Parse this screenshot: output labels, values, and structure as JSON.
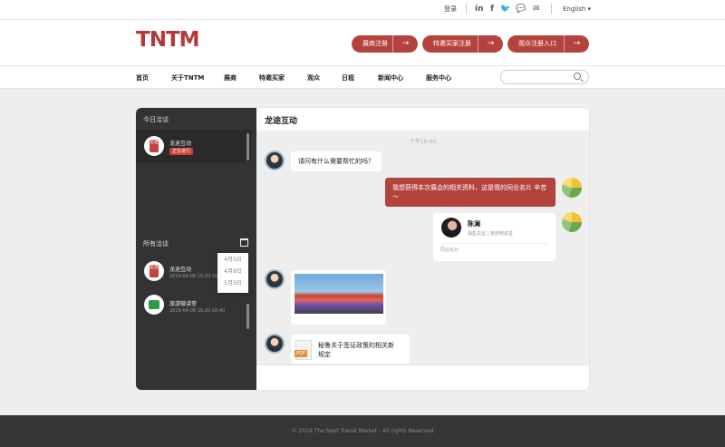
{
  "topbar": {
    "login": "登录",
    "social": [
      "in",
      "f",
      "t",
      "wechat",
      "mail"
    ],
    "social_labels": [
      "in",
      "f",
      "🐦",
      "💬",
      "✉"
    ],
    "language": "English"
  },
  "header": {
    "logo": "TNTM",
    "buttons": [
      "展商注册",
      "特邀买家注册",
      "观众注册入口"
    ]
  },
  "nav": {
    "items": [
      "首页",
      "关于TNTM",
      "展商",
      "特邀买家",
      "观众",
      "日程",
      "新闻中心",
      "服务中心"
    ],
    "search_placeholder": ""
  },
  "sidebar": {
    "today_title": "今日洽谈",
    "today": [
      {
        "name": "龙途互动",
        "badge": "正在进行"
      }
    ],
    "all_title": "所有洽谈",
    "all": [
      {
        "name": "龙途互动",
        "time": "2019-04-08  15:20-16:40"
      },
      {
        "name": "旅游微讲堂",
        "time": "2019-04-08  16:20-16:40"
      }
    ],
    "date_options": [
      "4月5日",
      "4月8日",
      "5月3日"
    ]
  },
  "chat": {
    "title": "龙途互动",
    "timestamp": "下午16:00",
    "msg1": "请问有什么需要帮忙的吗？",
    "msg2": "我想获得本次展会的相关资料，这是我的同业名片  辛苦～",
    "card": {
      "name": "陈澜",
      "role": "销售总监  |  旅游微讲堂",
      "footer": "同业名片"
    },
    "file": {
      "icon": "PDF",
      "name": "秘鲁关于签证政策的相关新规定"
    }
  },
  "footer": {
    "copyright": "© 2019 The Next Travel Market - All rights Reserved"
  },
  "colors": {
    "brand": "#b5433d",
    "sidebar": "#333333",
    "footer": "#363636"
  }
}
